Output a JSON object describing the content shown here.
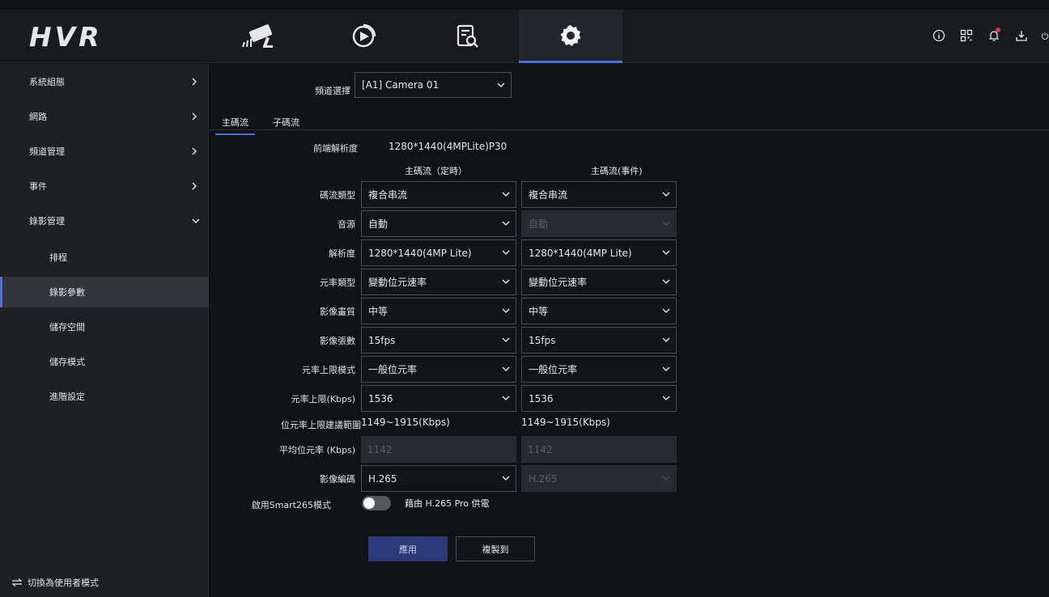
{
  "app": {
    "logo": "HVR"
  },
  "topnav": {
    "tabs": [
      {
        "name": "live-view",
        "icon": "camera-icon"
      },
      {
        "name": "playback",
        "icon": "playback-icon"
      },
      {
        "name": "search",
        "icon": "file-search-icon"
      },
      {
        "name": "settings",
        "icon": "gear-icon",
        "active": true
      }
    ],
    "right_icons": [
      "info-icon",
      "qr-code-icon",
      "bell-icon",
      "download-icon",
      "power-icon"
    ]
  },
  "sidebar": {
    "items": [
      {
        "label": "系統組態"
      },
      {
        "label": "網路"
      },
      {
        "label": "頻道管理"
      },
      {
        "label": "事件"
      },
      {
        "label": "錄影管理"
      },
      {
        "label": "排程"
      },
      {
        "label": "錄影參數"
      },
      {
        "label": "儲存空間"
      },
      {
        "label": "儲存模式"
      },
      {
        "label": "進階設定"
      }
    ],
    "switch_mode": "切換為使用者模式"
  },
  "form": {
    "channel_label": "頻道選擇",
    "channel_value": "[A1] Camera 01",
    "tabs": [
      "主碼流",
      "子碼流"
    ],
    "front_res_label": "前端解析度",
    "front_res_value": "1280*1440(4MPLite)P30",
    "col_headers": [
      "主碼流（定時）",
      "主碼流(事件)"
    ],
    "rows": [
      {
        "label": "碼流類型",
        "a": "複合串流",
        "b": "複合串流"
      },
      {
        "label": "音源",
        "a": "自動",
        "b": "自動"
      },
      {
        "label": "解析度",
        "a": "1280*1440(4MP Lite)",
        "b": "1280*1440(4MP Lite)"
      },
      {
        "label": "元率類型",
        "a": "變動位元速率",
        "b": "變動位元速率"
      },
      {
        "label": "影像畫質",
        "a": "中等",
        "b": "中等"
      },
      {
        "label": "影像張數",
        "a": "15fps",
        "b": "15fps"
      },
      {
        "label": "元率上限模式",
        "a": "一般位元率",
        "b": "一般位元率"
      },
      {
        "label": "元率上限(Kbps)",
        "a": "1536",
        "b": "1536"
      }
    ],
    "recommend_label": "位元率上限建議範圍",
    "recommend_a": "1149~1915(Kbps)",
    "recommend_b": "1149~1915(Kbps)",
    "avg_label": "平均位元率 (Kbps)",
    "avg_a": "1142",
    "avg_b": "1142",
    "codec_label": "影像編碼",
    "codec_a": "H.265",
    "codec_b": "H.265",
    "smart_label": "啟用Smart265模式",
    "smart_note": "藉由 H.265 Pro 供電",
    "apply": "應用",
    "copy_to": "複製到"
  }
}
